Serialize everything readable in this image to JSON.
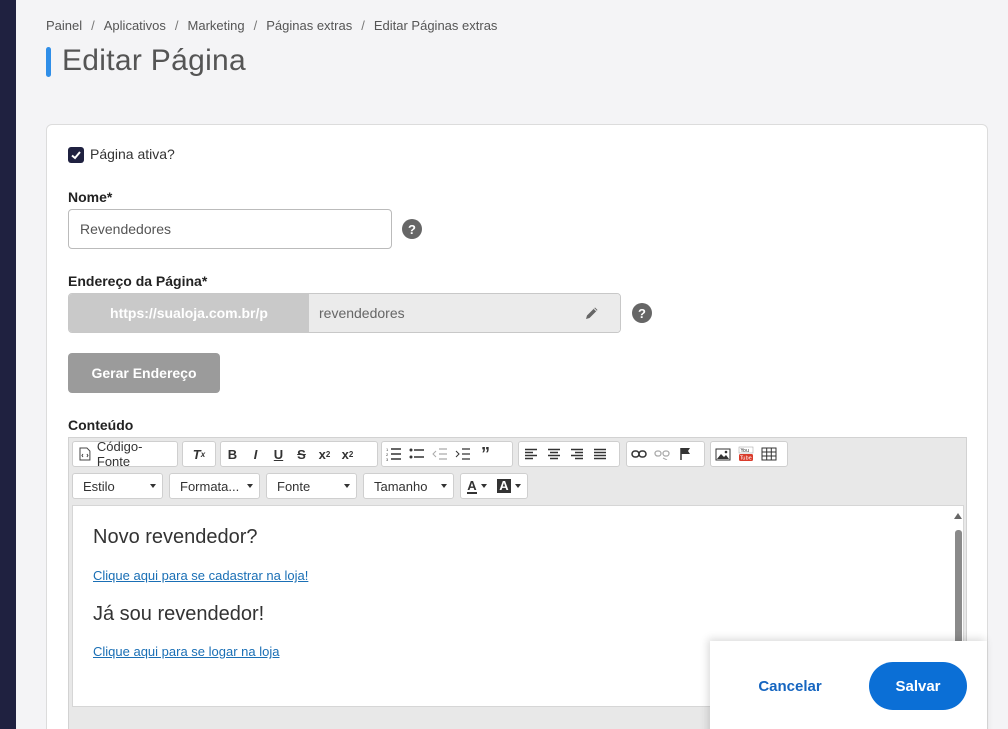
{
  "breadcrumb": [
    "Painel",
    "Aplicativos",
    "Marketing",
    "Páginas extras",
    "Editar Páginas extras"
  ],
  "page_title": "Editar Página",
  "form": {
    "active_label": "Página ativa?",
    "active_checked": true,
    "name_label": "Nome*",
    "name_value": "Revendedores",
    "address_label": "Endereço da Página*",
    "address_prefix": "https://sualoja.com.br/p",
    "address_slug": "revendedores",
    "generate_button": "Gerar Endereço",
    "content_label": "Conteúdo"
  },
  "editor": {
    "source_button": "Código-Fonte",
    "combos": {
      "style": "Estilo",
      "format": "Formata...",
      "font": "Fonte",
      "size": "Tamanho"
    },
    "content": {
      "heading1": "Novo revendedor?",
      "link1": "Clique aqui para se cadastrar na loja!",
      "heading2": "Já sou revendedor!",
      "link2": "Clique aqui para se logar na loja"
    }
  },
  "footer": {
    "cancel": "Cancelar",
    "save": "Salvar"
  },
  "colors": {
    "accent": "#2f8ee8",
    "primary_button": "#0b6fd6",
    "sidebar": "#1f2140"
  }
}
